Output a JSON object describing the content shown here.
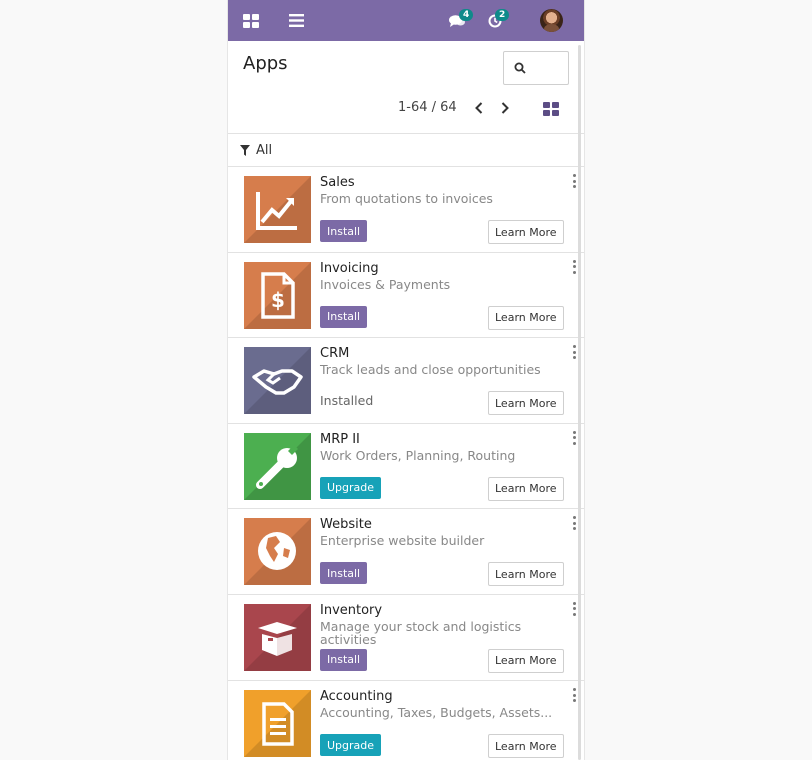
{
  "navbar": {
    "color": "#7c6aa6",
    "apps_menu_icon": "grid-icon",
    "hamburger_icon": "hamburger-icon",
    "messages_icon": "chat-bubbles-icon",
    "messages_count": "4",
    "activities_icon": "clock-icon",
    "activities_count": "2",
    "user_avatar": "avatar"
  },
  "control_panel": {
    "title": "Apps",
    "search_icon": "search-icon",
    "pager_value": "1-64 / 64",
    "prev_icon": "chevron-left-icon",
    "next_icon": "chevron-right-icon",
    "view_toggle_icon": "kanban-grid-icon"
  },
  "facet": {
    "icon": "filter-icon",
    "label": "All"
  },
  "apps": [
    {
      "name": "Sales",
      "summary": "From quotations to invoices",
      "action": "Install",
      "action_type": "install",
      "learn_more": "Learn More",
      "icon": "sales-chart-icon",
      "color": "#d67d4c"
    },
    {
      "name": "Invoicing",
      "summary": "Invoices & Payments",
      "action": "Install",
      "action_type": "install",
      "learn_more": "Learn More",
      "icon": "invoice-icon",
      "color": "#d67d4c"
    },
    {
      "name": "CRM",
      "summary": "Track leads and close opportunities",
      "action": "Installed",
      "action_type": "status",
      "learn_more": "Learn More",
      "icon": "handshake-icon",
      "color": "#6a6c8f"
    },
    {
      "name": "MRP II",
      "summary": "Work Orders, Planning, Routing",
      "action": "Upgrade",
      "action_type": "upgrade",
      "learn_more": "Learn More",
      "icon": "wrench-icon",
      "color": "#4caf50"
    },
    {
      "name": "Website",
      "summary": "Enterprise website builder",
      "action": "Install",
      "action_type": "install",
      "learn_more": "Learn More",
      "icon": "globe-icon",
      "color": "#d67d4c"
    },
    {
      "name": "Inventory",
      "summary": "Manage your stock and logistics activities",
      "action": "Install",
      "action_type": "install",
      "learn_more": "Learn More",
      "icon": "box-icon",
      "color": "#a9464d"
    },
    {
      "name": "Accounting",
      "summary": "Accounting, Taxes, Budgets, Assets...",
      "action": "Upgrade",
      "action_type": "upgrade",
      "learn_more": "Learn More",
      "icon": "document-icon",
      "color": "#f0a02b"
    }
  ]
}
